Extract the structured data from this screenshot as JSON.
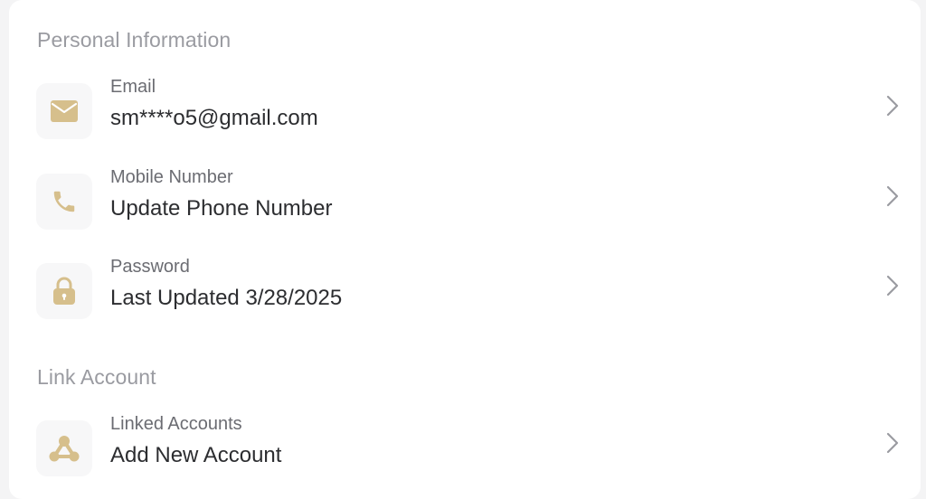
{
  "sections": {
    "personal": {
      "title": "Personal Information"
    },
    "link": {
      "title": "Link Account"
    }
  },
  "rows": {
    "email": {
      "label": "Email",
      "value": "sm****o5@gmail.com",
      "icon": "mail-icon"
    },
    "mobile": {
      "label": "Mobile Number",
      "value": "Update Phone Number",
      "icon": "phone-icon"
    },
    "password": {
      "label": "Password",
      "value": "Last Updated 3/28/2025",
      "icon": "lock-icon"
    },
    "linked": {
      "label": "Linked Accounts",
      "value": "Add New Account",
      "icon": "share-nodes-icon"
    }
  },
  "colors": {
    "accent": "#d6bf8c",
    "section_title": "#9a9ba1",
    "label": "#6b6c72",
    "value": "#2c2d30",
    "chevron": "#9a9ba1"
  }
}
